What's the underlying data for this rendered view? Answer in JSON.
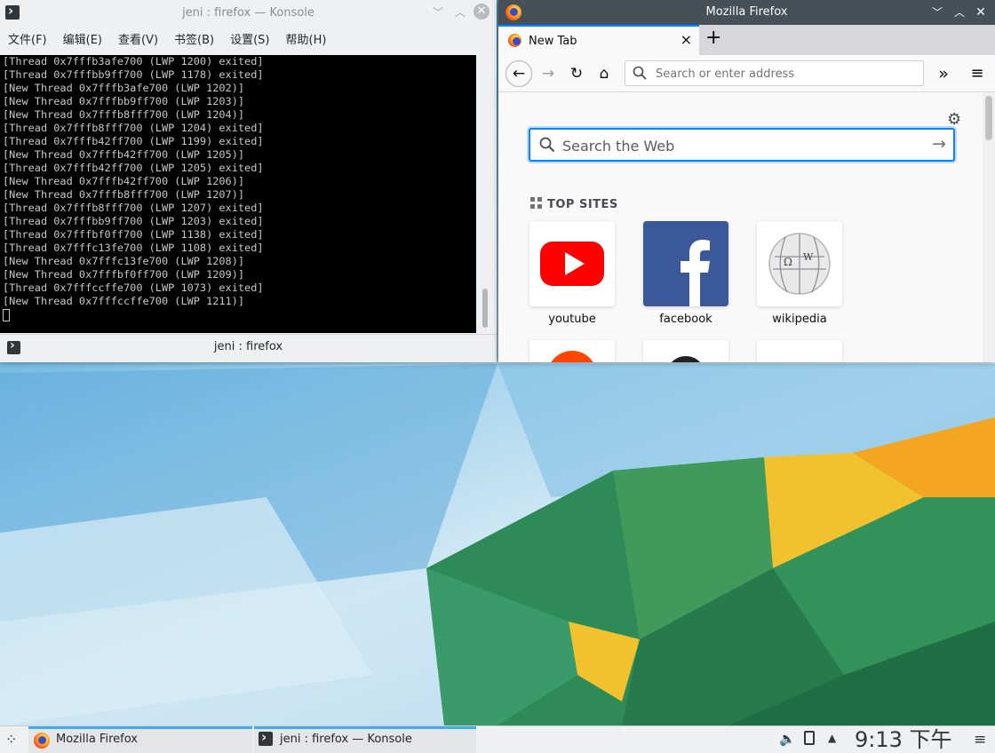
{
  "konsole": {
    "title": "jeni : firefox — Konsole",
    "menu": [
      "文件(F)",
      "编辑(E)",
      "查看(V)",
      "书签(B)",
      "设置(S)",
      "帮助(H)"
    ],
    "terminal_lines": [
      "[Thread 0x7fffb3afe700 (LWP 1200) exited]",
      "[Thread 0x7fffbb9ff700 (LWP 1178) exited]",
      "[New Thread 0x7fffb3afe700 (LWP 1202)]",
      "[New Thread 0x7fffbb9ff700 (LWP 1203)]",
      "[New Thread 0x7fffb8fff700 (LWP 1204)]",
      "[Thread 0x7fffb8fff700 (LWP 1204) exited]",
      "[Thread 0x7fffb42ff700 (LWP 1199) exited]",
      "[New Thread 0x7fffb42ff700 (LWP 1205)]",
      "[Thread 0x7fffb42ff700 (LWP 1205) exited]",
      "[New Thread 0x7fffb42ff700 (LWP 1206)]",
      "[New Thread 0x7fffb8fff700 (LWP 1207)]",
      "[Thread 0x7fffb8fff700 (LWP 1207) exited]",
      "[Thread 0x7fffbb9ff700 (LWP 1203) exited]",
      "[Thread 0x7fffbf0ff700 (LWP 1138) exited]",
      "[Thread 0x7fffc13fe700 (LWP 1108) exited]",
      "[New Thread 0x7fffc13fe700 (LWP 1208)]",
      "[New Thread 0x7fffbf0ff700 (LWP 1209)]",
      "[Thread 0x7fffccffe700 (LWP 1073) exited]",
      "[New Thread 0x7fffccffe700 (LWP 1211)]"
    ],
    "tab_label": "jeni : firefox"
  },
  "firefox": {
    "title": "Mozilla Firefox",
    "tab_label": "New Tab",
    "url_placeholder": "Search or enter address",
    "web_search_placeholder": "Search the Web",
    "top_sites_label": "TOP SITES",
    "top_sites": [
      {
        "label": "youtube",
        "color": "#ff0000"
      },
      {
        "label": "facebook",
        "color": "#3b5998"
      },
      {
        "label": "wikipedia",
        "color": "#ffffff"
      }
    ]
  },
  "taskbar": {
    "tasks": [
      "Mozilla Firefox",
      "jeni : firefox — Konsole"
    ],
    "clock": "9:13 下午"
  },
  "colors": {
    "accent": "#0a84ff",
    "plasma_blue": "#3daee9",
    "terminal_bg": "#000000"
  }
}
